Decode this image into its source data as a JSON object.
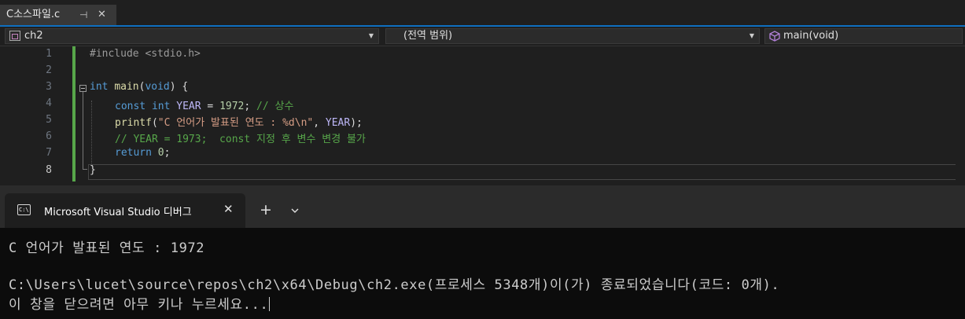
{
  "editor_tab": {
    "filename": "C소스파일.c",
    "pin_icon": "⊣",
    "close_icon": "✕"
  },
  "navbar": {
    "project": "ch2",
    "scope": "(전역 범위)",
    "member": "main(void)",
    "dropdown_arrow": "▼"
  },
  "editor": {
    "line_numbers": [
      "1",
      "2",
      "3",
      "4",
      "5",
      "6",
      "7",
      "8"
    ],
    "current_line": "8"
  },
  "code": {
    "l1": "#include <stdio.h>",
    "l3_kw": "int",
    "l3_fn": "main",
    "l3_open": "(",
    "l3_void": "void",
    "l3_close": ") {",
    "l4_kw1": "const",
    "l4_kw2": "int",
    "l4_var": "YEAR",
    "l4_mid": " = ",
    "l4_num": "1972",
    "l4_semi": "; ",
    "l4_cmt": "// 상수",
    "l5_fn": "printf",
    "l5_open": "(",
    "l5_str": "\"C 언어가 발표된 연도 : %d\\n\"",
    "l5_comma": ", ",
    "l5_var": "YEAR",
    "l5_end": ");",
    "l6_cmt": "// YEAR = 1973;  const 지정 후 변수 변경 불가",
    "l7_kw": "return",
    "l7_num": "0",
    "l7_end": ";",
    "l8": "}"
  },
  "terminal": {
    "tab_title": "Microsoft Visual Studio 디버그",
    "tab_close": "✕",
    "new_tab": "+",
    "output_line1": "C 언어가 발표된 연도 : 1972",
    "output_line2": "C:\\Users\\lucet\\source\\repos\\ch2\\x64\\Debug\\ch2.exe(프로세스 5348개)이(가) 종료되었습니다(코드: 0개).",
    "output_line3": "이 창을 닫으려면 아무 키나 누르세요..."
  }
}
